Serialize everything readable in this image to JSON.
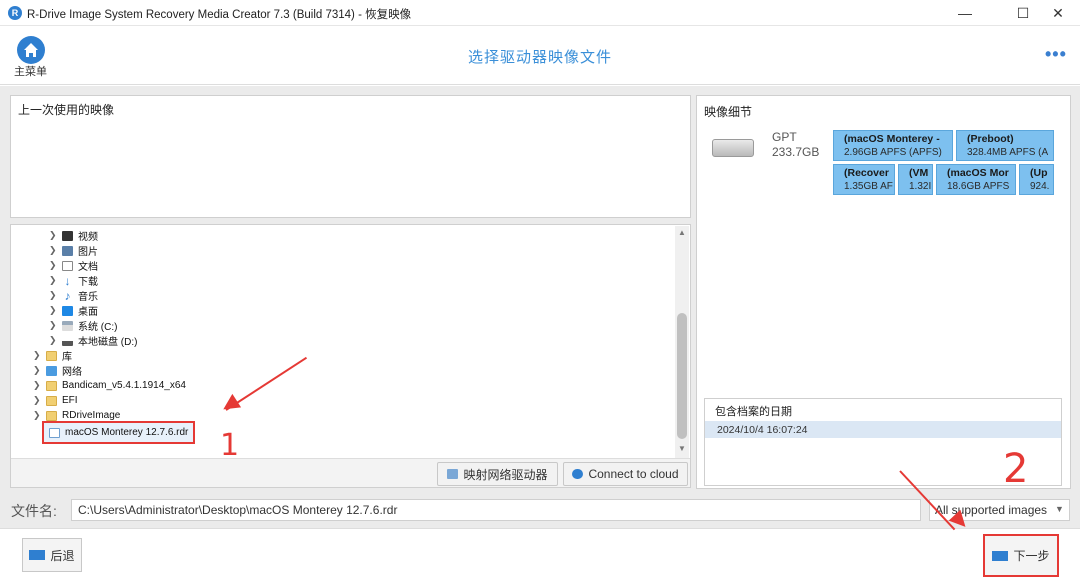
{
  "window": {
    "title": "R-Drive Image System Recovery Media Creator 7.3 (Build 7314) - 恢复映像",
    "logo_letter": "R"
  },
  "header": {
    "home_label": "主菜单",
    "page_title": "选择驱动器映像文件",
    "more_glyph": "•••"
  },
  "recent": {
    "title": "上一次使用的映像"
  },
  "tree": {
    "items": [
      {
        "label": "视频",
        "icon": "video-icon"
      },
      {
        "label": "图片",
        "icon": "pictures-icon"
      },
      {
        "label": "文档",
        "icon": "documents-icon"
      },
      {
        "label": "下载",
        "icon": "download-icon"
      },
      {
        "label": "音乐",
        "icon": "music-icon"
      },
      {
        "label": "桌面",
        "icon": "desktop-icon"
      },
      {
        "label": "系统 (C:)",
        "icon": "drive-icon"
      },
      {
        "label": "本地磁盘 (D:)",
        "icon": "drive-icon"
      },
      {
        "label": "库",
        "icon": "library-icon"
      },
      {
        "label": "网络",
        "icon": "network-icon"
      },
      {
        "label": "Bandicam_v5.4.1.1914_x64",
        "icon": "folder-icon"
      },
      {
        "label": "EFI",
        "icon": "folder-icon"
      },
      {
        "label": "RDriveImage",
        "icon": "folder-icon"
      },
      {
        "label": "macOS Monterey 12.7.6.rdr",
        "icon": "file-icon"
      }
    ],
    "map_drive_label": "映射网络驱动器",
    "cloud_label": "Connect to cloud"
  },
  "details": {
    "title": "映像细节",
    "disk_type": "GPT",
    "disk_size": "233.7GB",
    "partitions": [
      {
        "name": "(macOS Monterey -",
        "detail": "2.96GB APFS (APFS)"
      },
      {
        "name": "(Preboot)",
        "detail": "328.4MB APFS (A"
      },
      {
        "name": "(Recover",
        "detail": "1.35GB AF"
      },
      {
        "name": "(VM",
        "detail": "1.32I"
      },
      {
        "name": "(macOS Mor",
        "detail": "18.6GB APFS"
      },
      {
        "name": "(Up",
        "detail": "924."
      }
    ],
    "dates_header": "包含档案的日期",
    "dates": [
      "2024/10/4 16:07:24"
    ]
  },
  "file": {
    "label": "文件名:",
    "value": "C:\\Users\\Administrator\\Desktop\\macOS Monterey 12.7.6.rdr",
    "filter": "All supported images"
  },
  "footer": {
    "back_label": "后退",
    "next_label": "下一步"
  },
  "annotations": {
    "mark_one": "1",
    "mark_two": "2"
  },
  "colors": {
    "accent": "#2f7fd0",
    "highlight": "#e53935",
    "partition": "#7dc0ef"
  }
}
